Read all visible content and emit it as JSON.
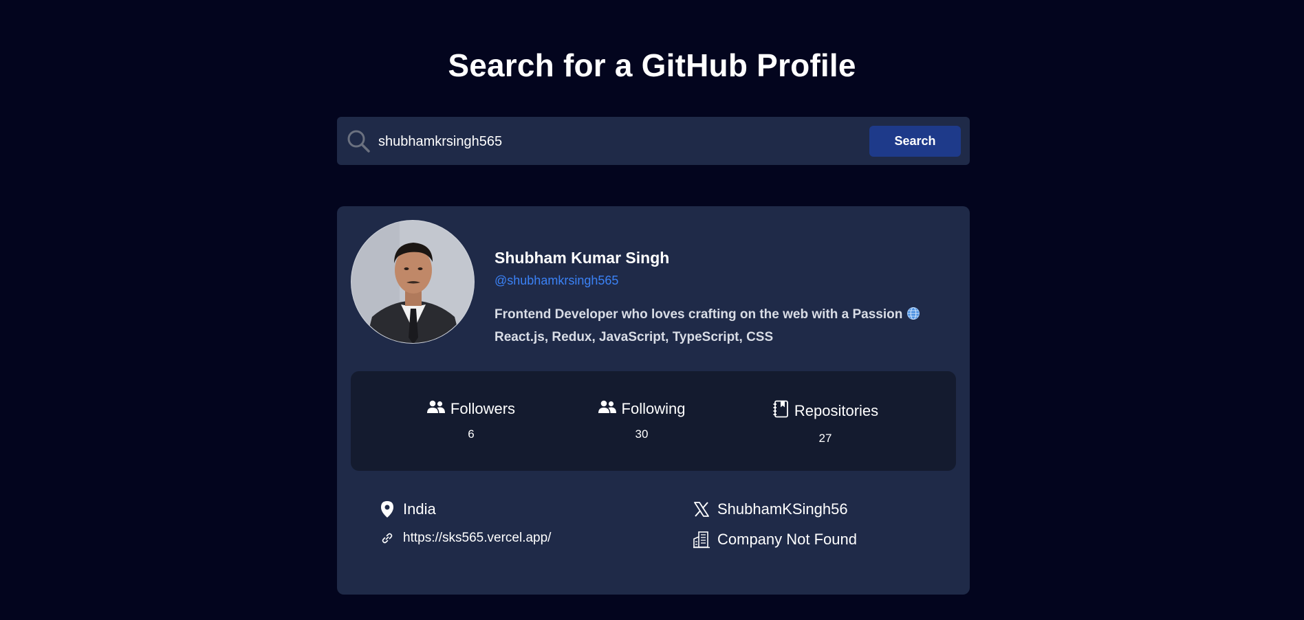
{
  "header": {
    "title": "Search for a GitHub Profile"
  },
  "search": {
    "value": "shubhamkrsingh565",
    "button_label": "Search",
    "icon": "search-icon"
  },
  "profile": {
    "name": "Shubham Kumar Singh",
    "handle": "@shubhamkrsingh565",
    "bio_line1": "Frontend Developer who loves crafting on the web with a Passion",
    "bio_line2": "React.js, Redux, JavaScript, TypeScript, CSS"
  },
  "stats": {
    "followers": {
      "label": "Followers",
      "value": "6",
      "icon": "users-icon"
    },
    "following": {
      "label": "Following",
      "value": "30",
      "icon": "users-icon"
    },
    "repositories": {
      "label": "Repositories",
      "value": "27",
      "icon": "book-icon"
    }
  },
  "details": {
    "location": {
      "text": "India",
      "icon": "location-pin-icon"
    },
    "website": {
      "text": "https://sks565.vercel.app/",
      "icon": "link-icon"
    },
    "twitter": {
      "text": "ShubhamKSingh56",
      "icon": "x-logo-icon"
    },
    "company": {
      "text": "Company Not Found",
      "icon": "building-icon"
    }
  },
  "colors": {
    "background": "#03051e",
    "card": "#1f2a48",
    "stats_panel": "#141b2f",
    "accent_button": "#1e3a8a",
    "link": "#3b82f6"
  }
}
